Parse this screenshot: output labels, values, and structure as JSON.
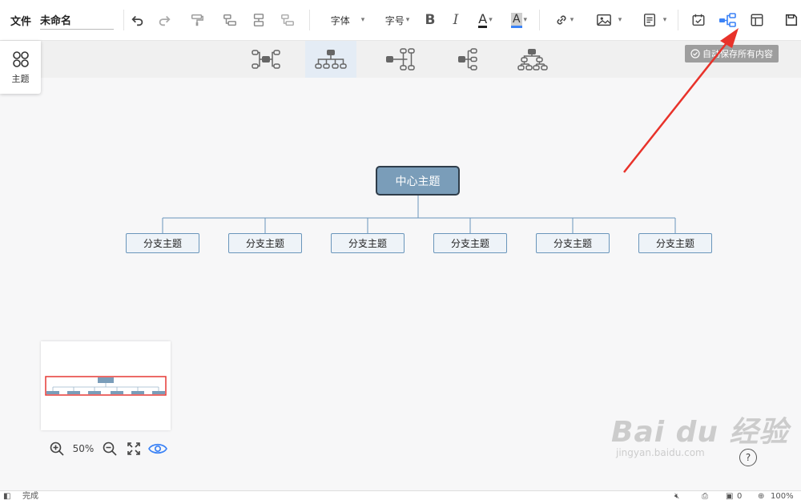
{
  "toolbar": {
    "file_menu": "文件",
    "document_name": "未命名",
    "font_label": "字体",
    "font_size_label": "字号",
    "bold_glyph": "B",
    "italic_glyph": "I",
    "font_color_glyph": "A",
    "highlight_glyph": "A"
  },
  "autosave_status": "自动保存所有内容",
  "theme_panel": {
    "label": "主题"
  },
  "mindmap": {
    "central_topic": "中心主题",
    "branches": [
      "分支主题",
      "分支主题",
      "分支主题",
      "分支主题",
      "分支主题",
      "分支主题"
    ]
  },
  "zoom": {
    "level": "50%"
  },
  "help_glyph": "?",
  "watermark": {
    "brand": "Bai du 经验",
    "url": "jingyan.baidu.com"
  },
  "statusbar": {
    "status": "完成",
    "mic_count": "0",
    "zoom": "100%"
  },
  "colors": {
    "accent": "#3b82f6",
    "central_fill": "#7a9db9",
    "central_border": "#2f3d4a",
    "branch_fill": "#eef3f8",
    "branch_border": "#6a96bb",
    "annotation_arrow": "#e8322a"
  }
}
